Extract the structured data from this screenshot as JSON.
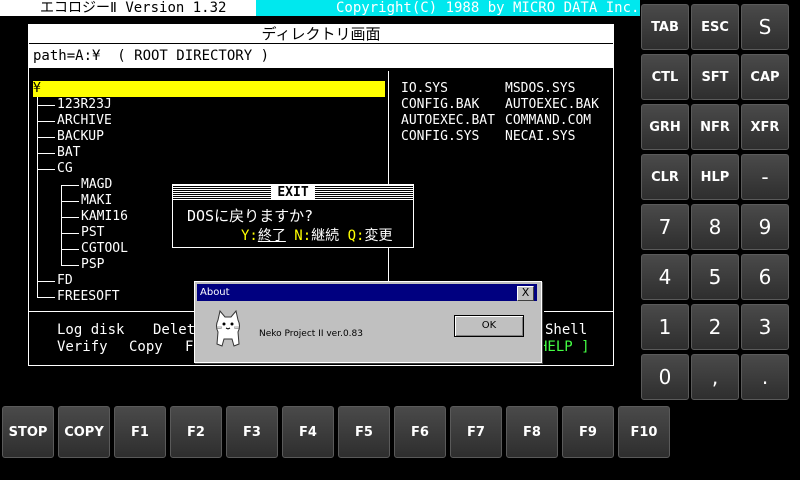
{
  "header": {
    "app_title": "エコロジーⅡ Version 1.32",
    "copyright": "Copyright(C) 1988 by MICRO DATA Inc."
  },
  "window": {
    "title": "ディレクトリ画面",
    "path": "path=A:¥  ( ROOT DIRECTORY )"
  },
  "tree": {
    "root": "¥",
    "items": [
      "123R23J",
      "ARCHIVE",
      "BACKUP",
      "BAT",
      "CG",
      "MAGD",
      "MAKI",
      "KAMI16",
      "PST",
      "CGTOOL",
      "PSP",
      "FD",
      "FREESOFT"
    ]
  },
  "files": {
    "col1": [
      "IO.SYS",
      "CONFIG.BAK",
      "AUTOEXEC.BAT",
      "CONFIG.SYS"
    ],
    "col2": [
      "MSDOS.SYS",
      "AUTOEXEC.BAK",
      "COMMAND.COM",
      "NECAI.SYS"
    ]
  },
  "commands": {
    "log_disk": "Log disk",
    "delete": "Delet",
    "verify": "Verify",
    "copy": "Copy",
    "f_partial": "F",
    "shell": "Shell",
    "help": "HELP ]"
  },
  "exit_dialog": {
    "title": "EXIT",
    "question": "DOSに戻りますか?",
    "opt_y_key": "Y:",
    "opt_y": "終了",
    "opt_n_key": "N:",
    "opt_n": "継続",
    "opt_q_key": "Q:",
    "opt_q": "変更"
  },
  "about_dialog": {
    "title": "About",
    "close": "X",
    "message": "Neko Project II ver.0.83",
    "ok": "OK"
  },
  "keypad": {
    "func": [
      "TAB",
      "ESC",
      "S",
      "CTL",
      "SFT",
      "CAP",
      "GRH",
      "NFR",
      "XFR",
      "CLR",
      "HLP",
      "-"
    ],
    "num": [
      "7",
      "8",
      "9",
      "4",
      "5",
      "6",
      "1",
      "2",
      "3",
      "0",
      ",",
      "."
    ]
  },
  "fkeys": [
    "STOP",
    "COPY",
    "F1",
    "F2",
    "F3",
    "F4",
    "F5",
    "F6",
    "F7",
    "F8",
    "F9",
    "F10"
  ]
}
